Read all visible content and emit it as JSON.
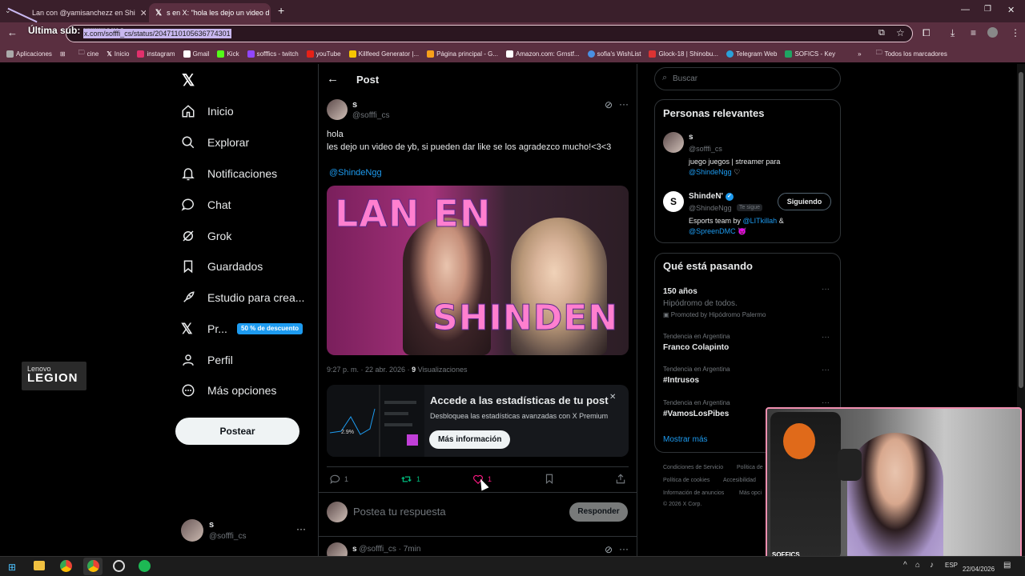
{
  "browser": {
    "tabs": [
      {
        "title": "Lan con @yamisanchezz en Shi"
      },
      {
        "title": "s en X: \"hola les dejo un video d"
      }
    ],
    "overlay_text": "Última sub: ",
    "overlay_name": "rrrrrrama",
    "url": "x.com/sofffi_cs/status/2047110105636774301",
    "bookmarks": [
      "Aplicaciones",
      "cine",
      "Inicio",
      "instagram",
      "Gmail",
      "Kick",
      "sofffics - twitch",
      "youTube",
      "Killfeed Generator |...",
      "Página principal - G...",
      "Amazon.com: Grnstf...",
      "sofia's WishList",
      "Glock-18 | Shinobu...",
      "Telegram Web",
      "SOFICS - Key"
    ],
    "bookmarks_folder": "Todos los marcadores"
  },
  "sidebar": {
    "items": [
      {
        "label": "Inicio"
      },
      {
        "label": "Explorar"
      },
      {
        "label": "Notificaciones"
      },
      {
        "label": "Chat"
      },
      {
        "label": "Grok"
      },
      {
        "label": "Guardados"
      },
      {
        "label": "Estudio para crea..."
      },
      {
        "label": "Pr..."
      },
      {
        "label": "Perfil"
      },
      {
        "label": "Más opciones"
      }
    ],
    "premium_badge": "50 % de descuento",
    "post_button": "Postear",
    "account": {
      "name": "s",
      "handle": "@sofffi_cs"
    }
  },
  "brand": {
    "line1": "Lenovo",
    "line2": "LEGION"
  },
  "post": {
    "header_title": "Post",
    "author_name": "s",
    "author_handle": "@sofffi_cs",
    "text_line1": "hola",
    "text_line2": "les dejo un video de yb, si pueden dar like se los agradezco mucho!<3<3",
    "mention": "@ShindeNgg",
    "thumb_top": "LAN EN",
    "thumb_bottom": "SHINDEN",
    "timestamp": "9:27 p. m. · 22 abr. 2026 · ",
    "views_count": "9",
    "views_label": " Visualizaciones",
    "promo": {
      "title": "Accede a las estadísticas de tu post",
      "subtitle": "Desbloquea las estadísticas avanzadas con X Premium",
      "button": "Más información",
      "stat": "2.9%"
    },
    "actions": {
      "replies": "1",
      "reposts": "1",
      "likes": "1"
    },
    "reply_placeholder": "Postea tu respuesta",
    "reply_button": "Responder",
    "next_reply": {
      "name": "s",
      "handle": "@sofffi_cs",
      "time": "· 7min"
    }
  },
  "right": {
    "search_placeholder": "Buscar",
    "relevant_title": "Personas relevantes",
    "people": [
      {
        "name": "s",
        "handle": "@sofffi_cs",
        "bio_line1": "juego juegos | streamer para",
        "bio_mention": "@ShindeNgg",
        "bio_emoji": "♡"
      },
      {
        "name": "ShindeN'",
        "handle": "@ShindeNgg",
        "follows_you": "Te sigue",
        "follow_button": "Siguiendo",
        "bio_text": "Esports team by ",
        "bio_mention1": "@LITkillah",
        "bio_amp": " &",
        "bio_mention2": "@SpreenDMC",
        "bio_emoji": "😈"
      }
    ],
    "trends_title": "Qué está pasando",
    "trends": [
      {
        "title": "150 años",
        "sub": "Hipódromo de todos.",
        "promoted": "Promoted by Hipódromo Palermo"
      },
      {
        "category": "Tendencia en Argentina",
        "title": "Franco Colapinto"
      },
      {
        "category": "Tendencia en Argentina",
        "title": "#Intrusos"
      },
      {
        "category": "Tendencia en Argentina",
        "title": "#VamosLosPibes"
      }
    ],
    "show_more": "Mostrar más",
    "footer": [
      "Condiciones de Servicio",
      "Política de",
      "Política de cookies",
      "Accesibilidad",
      "Información de anuncios",
      "Más opci",
      "© 2026 X Corp."
    ]
  },
  "webcam": {
    "label": "SOFFICS"
  },
  "taskbar": {
    "lang": "ESP",
    "date": "22/04/2026"
  }
}
